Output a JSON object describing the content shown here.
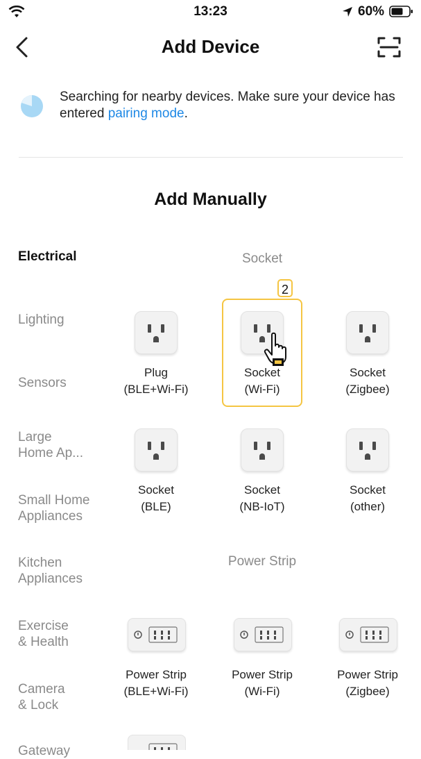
{
  "status_bar": {
    "time": "13:23",
    "battery": "60%"
  },
  "header": {
    "title": "Add Device"
  },
  "search": {
    "text_before": "Searching for nearby devices. Make sure your device has entered ",
    "link": "pairing mode",
    "text_after": "."
  },
  "section_title": "Add Manually",
  "categories": [
    {
      "label": "Electrical"
    },
    {
      "label": "Lighting"
    },
    {
      "label": "Sensors"
    },
    {
      "label": "Large\nHome Ap..."
    },
    {
      "label": "Small Home\nAppliances"
    },
    {
      "label": "Kitchen\nAppliances"
    },
    {
      "label": "Exercise\n& Health"
    },
    {
      "label": "Camera\n& Lock"
    },
    {
      "label": "Gateway"
    }
  ],
  "groups": [
    {
      "title": "Socket",
      "items": [
        {
          "name": "Plug",
          "sub": "(BLE+Wi-Fi)"
        },
        {
          "name": "Socket",
          "sub": "(Wi-Fi)"
        },
        {
          "name": "Socket",
          "sub": "(Zigbee)"
        },
        {
          "name": "Socket",
          "sub": "(BLE)"
        },
        {
          "name": "Socket",
          "sub": "(NB-IoT)"
        },
        {
          "name": "Socket",
          "sub": "(other)"
        }
      ]
    },
    {
      "title": "Power Strip",
      "items": [
        {
          "name": "Power Strip",
          "sub": "(BLE+Wi-Fi)"
        },
        {
          "name": "Power Strip",
          "sub": "(Wi-Fi)"
        },
        {
          "name": "Power Strip",
          "sub": "(Zigbee)"
        }
      ]
    }
  ],
  "highlight_badge": "2",
  "colors": {
    "accent": "#1e88e5",
    "highlight": "#f5c542"
  }
}
